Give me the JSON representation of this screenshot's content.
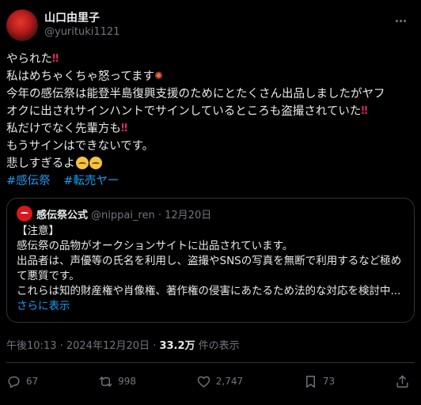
{
  "author": {
    "display_name": "山口由里子",
    "handle": "@yurituki1121"
  },
  "post": {
    "lines": [
      "やられた",
      "私はめちゃくちゃ怒ってます",
      "今年の感伝祭は能登半島復興支援のためにとたくさん出品しましたがヤフ",
      "オクに出されサインハントでサインしているところも盗撮されていた",
      "私だけでなく先輩方も",
      "もうサインはできないです。",
      "悲しすぎるよ"
    ],
    "hashtags": [
      "#感伝祭",
      "#転売ヤー"
    ]
  },
  "quote": {
    "name": "感伝祭公式",
    "handle_date": "@nippai_ren · 12月20日",
    "lines": [
      "【注意】",
      "感伝祭の品物がオークションサイトに出品されています。",
      "出品者は、声優等の氏名を利用し、盗撮やSNSの写真を無断で利用するなど極め",
      "て悪質です。",
      "これらは知的財産権や肖像権、著作権の侵害にあたるため法的な対応を検討中..."
    ],
    "show_more": "さらに表示"
  },
  "meta": {
    "timestamp": "午後10:13 · 2024年12月20日 · ",
    "views_count": "33.2万",
    "views_label": " 件の表示"
  },
  "actions": {
    "replies": "67",
    "reposts": "998",
    "likes": "2,747",
    "bookmarks": "73"
  },
  "icons": {
    "emoji_1": "double-exclamation-icon",
    "emoji_2": "anger-symbol-icon",
    "emoji_3": "loudly-crying-face-icon",
    "reply": "reply-icon",
    "repost": "repost-icon",
    "like": "heart-icon",
    "bookmarks": "bookmark-icon",
    "share": "share-icon",
    "more": "more-icon"
  }
}
